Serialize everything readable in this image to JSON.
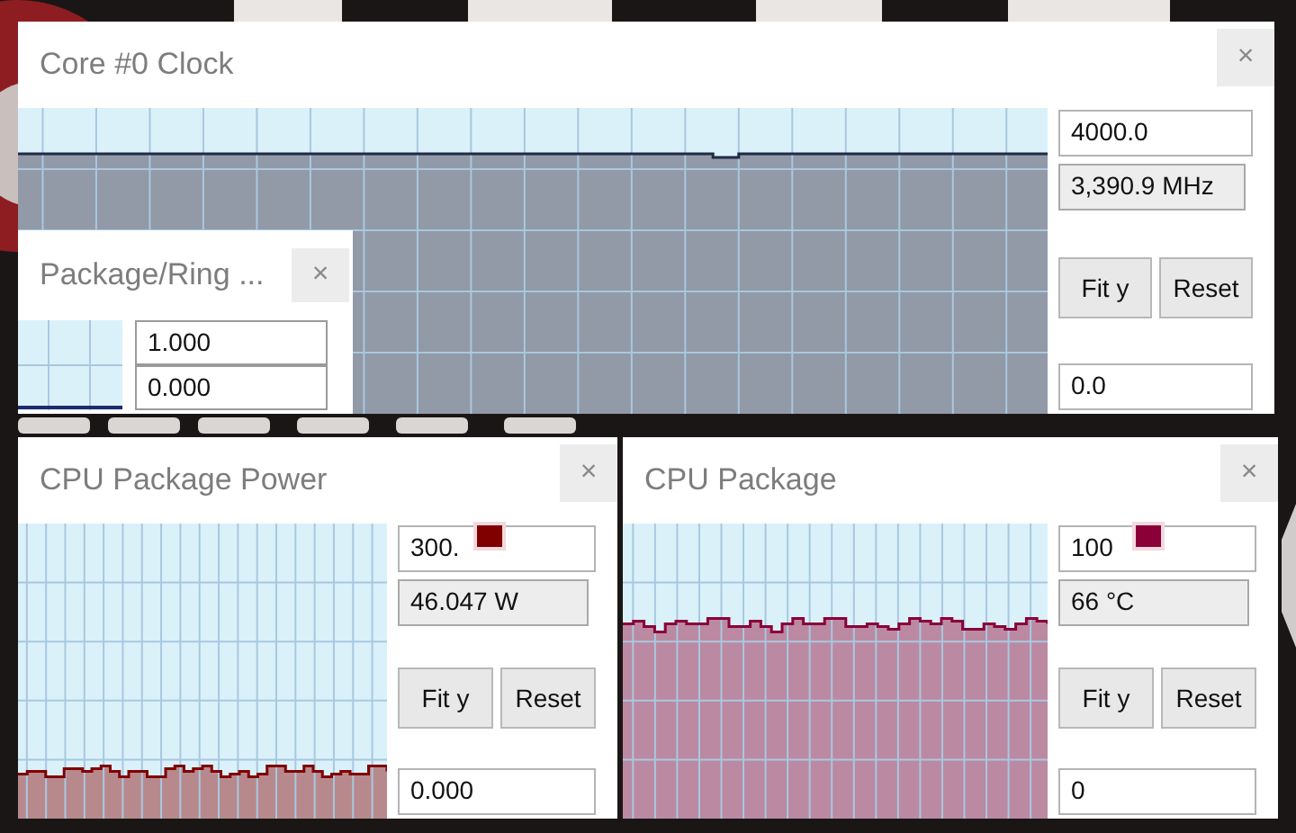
{
  "windows": [
    {
      "kind": "full",
      "title": "Core #0 Clock",
      "close": "×",
      "max": "4000.0",
      "reading": "3,390.9 MHz",
      "fit_button": "Fit y",
      "reset_button": "Reset",
      "min": "0.0",
      "color": "#1f2a44",
      "swatch": false
    },
    {
      "kind": "partial",
      "title": "Package/Ring ...",
      "close": "×",
      "fields": [
        "1.000",
        "0.000"
      ]
    },
    {
      "kind": "full",
      "title": "CPU Package Power",
      "close": "×",
      "max": "300.",
      "reading": "46.047 W",
      "fit_button": "Fit y",
      "reset_button": "Reset",
      "min": "0.000",
      "color": "#800000",
      "swatch": true
    },
    {
      "kind": "full",
      "title": "CPU Package",
      "close": "×",
      "max": "100",
      "reading": "66 °C",
      "fit_button": "Fit y",
      "reset_button": "Reset",
      "min": "0",
      "color": "#8b0038",
      "swatch": true
    }
  ]
}
